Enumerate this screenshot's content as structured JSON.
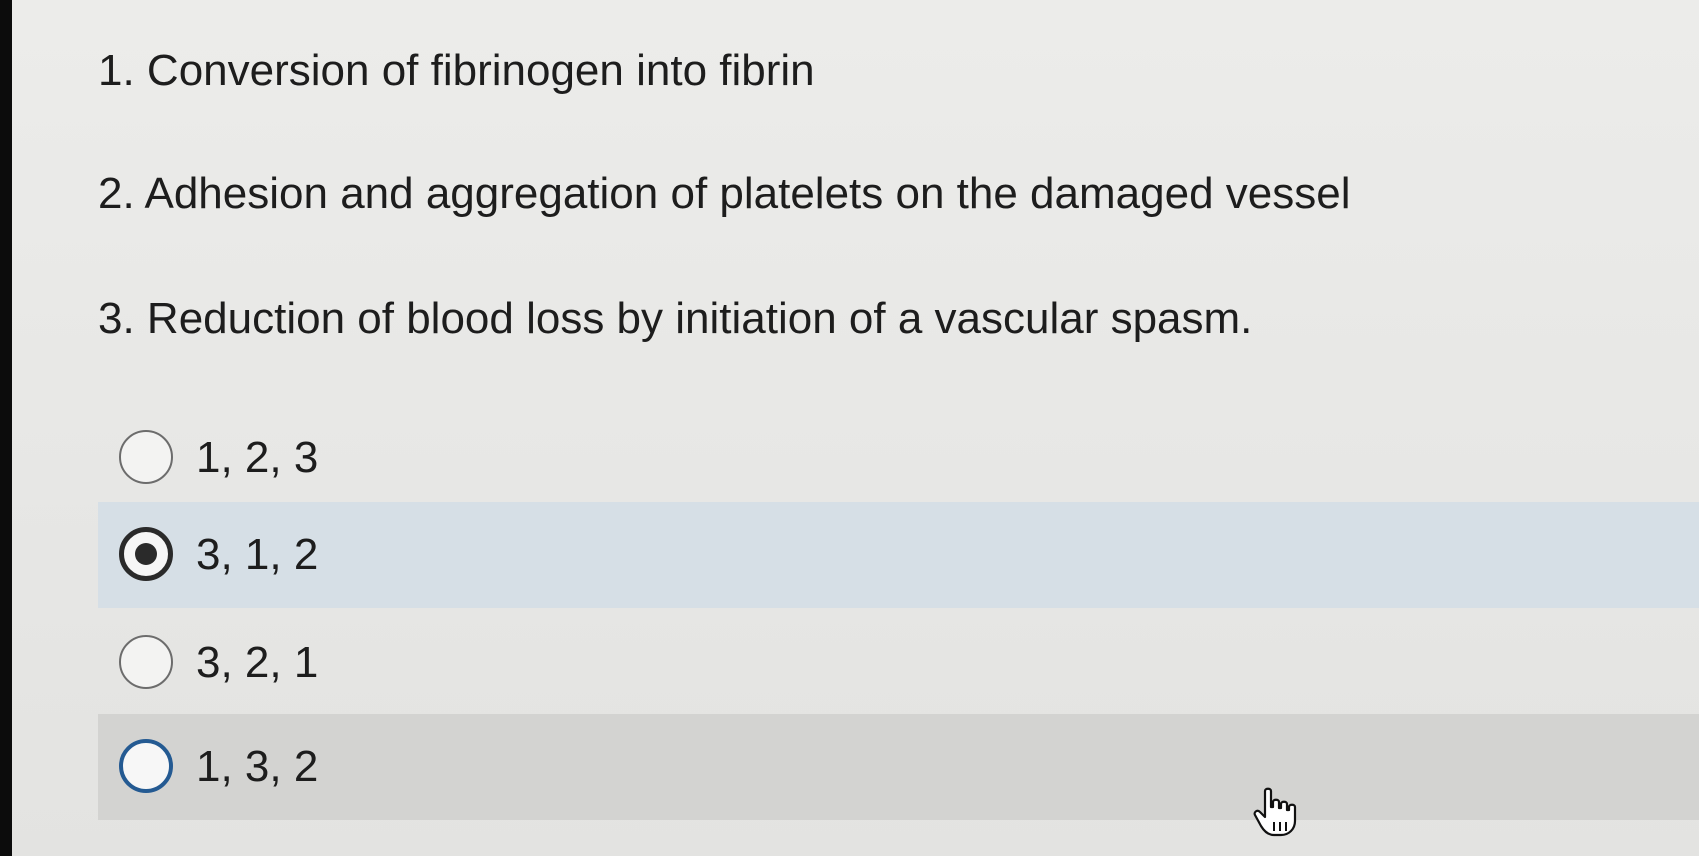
{
  "question": {
    "statements": [
      "1. Conversion of fibrinogen into fibrin",
      "2. Adhesion and aggregation of platelets on the damaged vessel",
      "3. Reduction of blood loss by initiation of a vascular spasm."
    ]
  },
  "options": [
    {
      "label": "1, 2, 3",
      "selected": false
    },
    {
      "label": "3, 1, 2",
      "selected": true
    },
    {
      "label": "3, 2, 1",
      "selected": false
    },
    {
      "label": "1, 3, 2",
      "selected": false
    }
  ],
  "colors": {
    "selected_row": "#d6dfe6",
    "hover_row": "#d3d3d1",
    "focus_ring": "#245a92"
  },
  "icons": {
    "cursor": "hand-pointer-icon"
  }
}
